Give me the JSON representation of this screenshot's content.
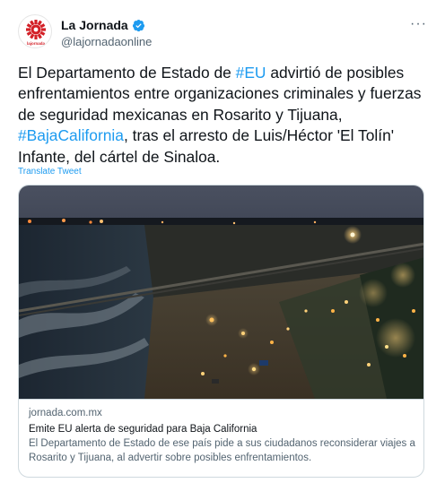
{
  "account": {
    "display_name": "La Jornada",
    "handle": "@lajornadaonline",
    "avatar_caption": "lajornada",
    "verified": true,
    "more_glyph": "···"
  },
  "tweet": {
    "segments": [
      {
        "text": "El Departamento de Estado de ",
        "type": "text"
      },
      {
        "text": "#EU",
        "type": "hashtag"
      },
      {
        "text": " advirtió de posibles enfrentamientos entre organizaciones criminales y fuerzas de seguridad mexicanas en Rosarito y Tijuana, ",
        "type": "text"
      },
      {
        "text": "#BajaCalifornia",
        "type": "hashtag"
      },
      {
        "text": ", tras el arresto de Luis/Héctor 'El Tolín' Infante, del cártel de Sinaloa.",
        "type": "text"
      }
    ],
    "translate_label": "Translate Tweet"
  },
  "link_card": {
    "domain": "jornada.com.mx",
    "title": "Emite EU alerta de seguridad para Baja California",
    "description": "El Departamento de Estado de ese país pide a sus ciudadanos reconsiderar viajes a Rosarito y Tijuana, al advertir sobre posibles enfrentamientos.",
    "image_subject": "night-aerial-beach-border-fence"
  },
  "colors": {
    "accent": "#1d9bf0",
    "text": "#0f1419",
    "secondary": "#536471",
    "border": "#cfd9de",
    "brand_red": "#d32027"
  }
}
